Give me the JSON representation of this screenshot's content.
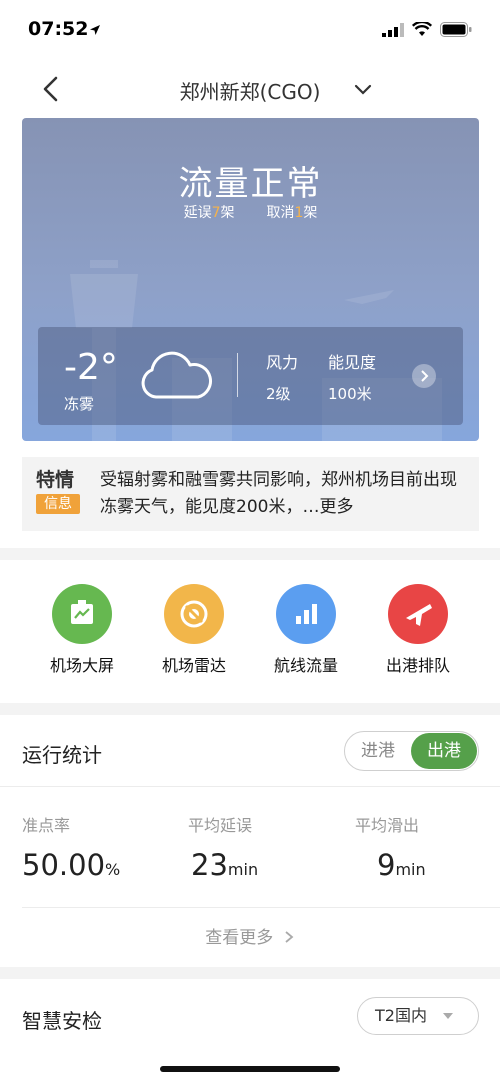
{
  "status_bar": {
    "time": "07:52"
  },
  "nav": {
    "title": "郑州新郑(CGO)"
  },
  "weather_card": {
    "flow_status": "流量正常",
    "delay_label": "延误",
    "delay_count": "7",
    "cancel_label": "取消",
    "cancel_count": "1",
    "unit": "架",
    "temperature": "-2°",
    "condition": "冻雾",
    "wind_label": "风力",
    "wind_value": "2级",
    "visibility_label": "能见度",
    "visibility_value": "100米"
  },
  "notice": {
    "badge_top": "特情",
    "badge_bottom": "信息",
    "text": "受辐射雾和融雪雾共同影响，郑州机场目前出现冻雾天气，能见度200米，…",
    "more": "更多"
  },
  "actions": [
    {
      "label": "机场大屏",
      "icon": "screen-icon",
      "color": "#66b850"
    },
    {
      "label": "机场雷达",
      "icon": "radar-icon",
      "color": "#f2b64a"
    },
    {
      "label": "航线流量",
      "icon": "bar-chart-icon",
      "color": "#5b9ef0"
    },
    {
      "label": "出港排队",
      "icon": "airplane-icon",
      "color": "#e84545"
    }
  ],
  "stats": {
    "title": "运行统计",
    "tab_in": "进港",
    "tab_out": "出港",
    "metrics": [
      {
        "label": "准点率",
        "value": "50.00",
        "unit": "%"
      },
      {
        "label": "平均延误",
        "value": "23",
        "unit": "min"
      },
      {
        "label": "平均滑出",
        "value": "9",
        "unit": "min"
      }
    ],
    "more": "查看更多"
  },
  "security": {
    "title": "智慧安检",
    "terminal": "T2国内"
  }
}
